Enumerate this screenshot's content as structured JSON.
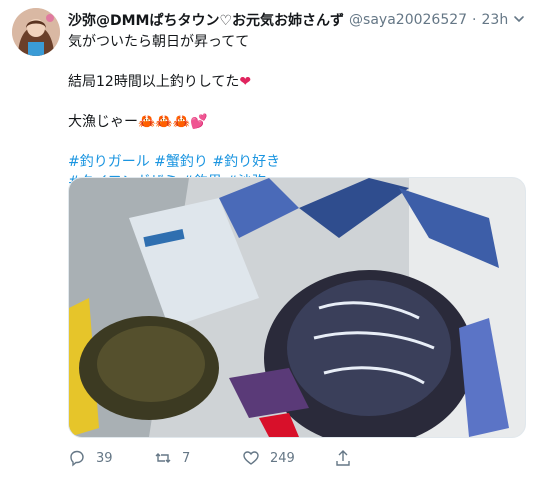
{
  "user": {
    "display_name": "沙弥@DMMぱちタウン♡お元気お姉さんず",
    "handle": "@saya20026527",
    "separator": "·",
    "time": "23h"
  },
  "tweet": {
    "line1": "気がついたら朝日が昇ってて",
    "line2": "結局12時間以上釣りしてた",
    "line3": "大漁じゃー",
    "tags_line1": "#釣りガール #蟹釣り #釣り好き",
    "tags_line2": "#タイワンガザミ #釣果 #沙弥",
    "emoji_heart": "❤",
    "emoji_crabs": "🦀🦀🦀",
    "emoji_hearts2": "💕"
  },
  "actions": {
    "reply_count": "39",
    "retweet_count": "7",
    "like_count": "249"
  },
  "colors": {
    "link": "#1b95e0",
    "muted": "#657786",
    "heart": "#e0245e"
  }
}
